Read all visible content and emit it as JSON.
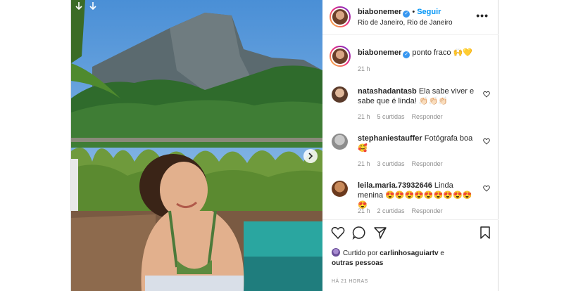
{
  "post": {
    "username": "biabonemer",
    "follow_label": "Seguir",
    "location": "Rio de Janeiro, Rio de Janeiro",
    "more_icon": "more-horizontal-icon"
  },
  "caption": {
    "username": "biabonemer",
    "text": "ponto fraco 🙌💛",
    "time": "21 h"
  },
  "comments": [
    {
      "username": "natashadantasb",
      "text": "Ela sabe viver e sabe que é linda! 👏🏻👏🏻👏🏻",
      "time": "21 h",
      "likes": "5 curtidas",
      "reply": "Responder"
    },
    {
      "username": "stephaniestauffer",
      "text": "Fotógrafa boa 🥰",
      "time": "21 h",
      "likes": "3 curtidas",
      "reply": "Responder"
    },
    {
      "username": "leila.maria.73932646",
      "text": "Linda menina 😍😍😍😍😍😍😍😍😍😍",
      "time": "21 h",
      "likes": "2 curtidas",
      "reply": "Responder"
    }
  ],
  "liked_by": {
    "prefix": "Curtido por",
    "user": "carlinhosaguiartv",
    "suffix": "e",
    "others": "outras pessoas"
  },
  "timestamp": "HÁ 21 HORAS",
  "colors": {
    "accent": "#0095f6",
    "verified": "#3897f0",
    "muted": "#8e8e8e"
  }
}
